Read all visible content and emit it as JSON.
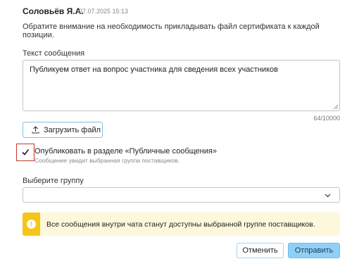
{
  "message_header": {
    "author": "Соловьёв Я.А.",
    "timestamp": "07.07.2025 15:13",
    "notice": "Обратите внимание на необходимость прикладывать файл сертификата к каждой позиции."
  },
  "reply_form": {
    "message_label": "Текст сообщения",
    "message_value": "Публикуем ответ на вопрос участника для сведения всех участников",
    "counter": "64/10000",
    "upload_label": "Загрузить файл",
    "publish_checkbox": {
      "checked": true,
      "label": "Опубликовать в разделе «Публичные сообщения»",
      "hint": "Сообщение увидит выбранная группа поставщиков."
    },
    "group_label": "Выберите группу",
    "group_value": "",
    "alert_text": "Все сообщения внутри чата станут доступны выбранной группе поставщиков.",
    "cancel_label": "Отменить",
    "send_label": "Отправить"
  },
  "icons": {
    "upload": "upload-icon",
    "checkmark": "check-icon",
    "chevron": "chevron-down-icon",
    "alert": "exclamation-icon"
  },
  "colors": {
    "accent_border": "#6cc0f1",
    "send_button_bg": "#8fd0f6",
    "alert_bg": "#fdf7dc",
    "alert_strip": "#f5c518",
    "highlight_border": "#c0392b"
  }
}
